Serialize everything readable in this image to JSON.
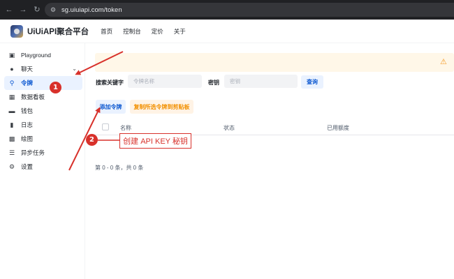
{
  "browser": {
    "url": "sg.uiuiapi.com/token",
    "back_icon": "arrow-left-icon",
    "forward_icon": "arrow-right-icon",
    "reload_icon": "reload-icon"
  },
  "header": {
    "brand": "UiUiAPI聚合平台",
    "nav": [
      "首页",
      "控制台",
      "定价",
      "关于"
    ]
  },
  "sidebar": {
    "items": [
      {
        "label": "Playground",
        "icon": "chat-square-icon"
      },
      {
        "label": "聊天",
        "icon": "chat-bubble-icon"
      },
      {
        "label": "令牌",
        "icon": "key-icon",
        "active": true
      },
      {
        "label": "数据看板",
        "icon": "dashboard-icon"
      },
      {
        "label": "钱包",
        "icon": "wallet-icon"
      },
      {
        "label": "日志",
        "icon": "bar-chart-icon"
      },
      {
        "label": "绘图",
        "icon": "image-icon"
      },
      {
        "label": "异步任务",
        "icon": "task-list-icon"
      },
      {
        "label": "设置",
        "icon": "gear-icon"
      }
    ]
  },
  "search": {
    "keyword_label": "搜索关键字",
    "keyword_placeholder": "令牌名称",
    "key_label": "密钥",
    "key_placeholder": "密钥",
    "query_button": "查询"
  },
  "actions": {
    "add_token": "添加令牌",
    "copy_tokens": "复制所选令牌到剪贴板"
  },
  "table": {
    "columns": [
      "名称",
      "状态",
      "已用额度"
    ]
  },
  "pager": {
    "summary": "第 0 - 0 条，共 0 条"
  },
  "annotations": {
    "badge_1": "1",
    "badge_2": "2",
    "callout": "创建 API KEY 秘钥",
    "color": "#d8312b"
  },
  "colors": {
    "accent": "#0b57d0",
    "warning": "#f59a23",
    "copy_button_text": "#f29000"
  }
}
